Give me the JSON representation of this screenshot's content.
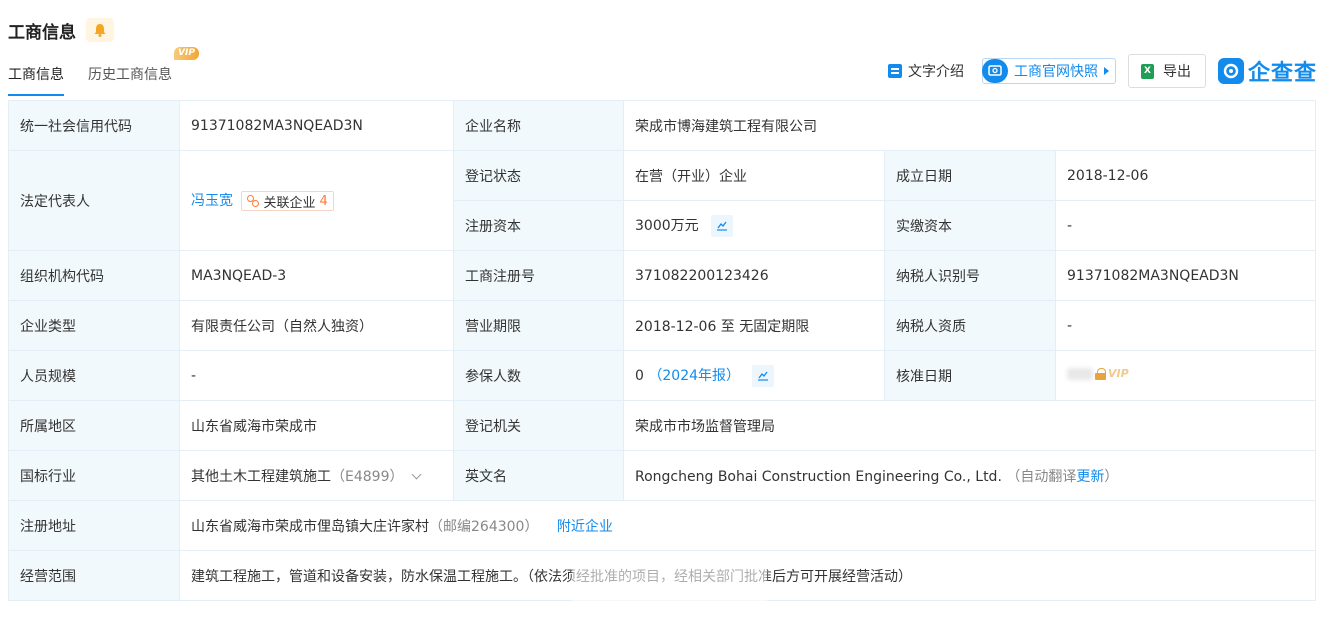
{
  "header": {
    "title": "工商信息",
    "tabs": [
      {
        "label": "工商信息",
        "active": true
      },
      {
        "label": "历史工商信息",
        "badge": "VIP"
      }
    ]
  },
  "actions": {
    "intro": "文字介绍",
    "snapshot": "工商官网快照",
    "export": "导出",
    "brand": "企查查"
  },
  "rows": {
    "credit_code": {
      "label": "统一社会信用代码",
      "value": "91371082MA3NQEAD3N"
    },
    "company_name": {
      "label": "企业名称",
      "value": "荣成市博海建筑工程有限公司"
    },
    "legal_rep": {
      "label": "法定代表人",
      "value": "冯玉宽",
      "related_label": "关联企业",
      "related_count": "4"
    },
    "reg_status": {
      "label": "登记状态",
      "value": "在营（开业）企业"
    },
    "founded": {
      "label": "成立日期",
      "value": "2018-12-06"
    },
    "reg_capital": {
      "label": "注册资本",
      "value": "3000万元"
    },
    "paid_capital": {
      "label": "实缴资本",
      "value": "-"
    },
    "org_code": {
      "label": "组织机构代码",
      "value": "MA3NQEAD-3"
    },
    "reg_no": {
      "label": "工商注册号",
      "value": "371082200123426"
    },
    "taxpayer_id": {
      "label": "纳税人识别号",
      "value": "91371082MA3NQEAD3N"
    },
    "company_type": {
      "label": "企业类型",
      "value": "有限责任公司（自然人独资）"
    },
    "term": {
      "label": "营业期限",
      "value": "2018-12-06 至 无固定期限"
    },
    "taxpayer_qual": {
      "label": "纳税人资质",
      "value": "-"
    },
    "staff_size": {
      "label": "人员规模",
      "value": "-"
    },
    "insured": {
      "label": "参保人数",
      "value": "0",
      "report": "（2024年报）"
    },
    "approve_date": {
      "label": "核准日期",
      "value": "VIP"
    },
    "region": {
      "label": "所属地区",
      "value": "山东省威海市荣成市"
    },
    "authority": {
      "label": "登记机关",
      "value": "荣成市市场监督管理局"
    },
    "industry": {
      "label": "国标行业",
      "value": "其他土木工程建筑施工",
      "code": "（E4899）"
    },
    "english_name": {
      "label": "英文名",
      "value": "Rongcheng Bohai Construction Engineering Co., Ltd.",
      "auto": "（自动翻译",
      "update": "更新",
      "close": "）"
    },
    "address": {
      "label": "注册地址",
      "value": "山东省威海市荣成市俚岛镇大庄许家村",
      "postcode": "（邮编264300）",
      "nearby": "附近企业"
    },
    "scope": {
      "label": "经营范围",
      "value": "建筑工程施工，管道和设备安装，防水保温工程施工。（依法须经批准的项目，经相关部门批准后方可开展经营活动）"
    }
  }
}
